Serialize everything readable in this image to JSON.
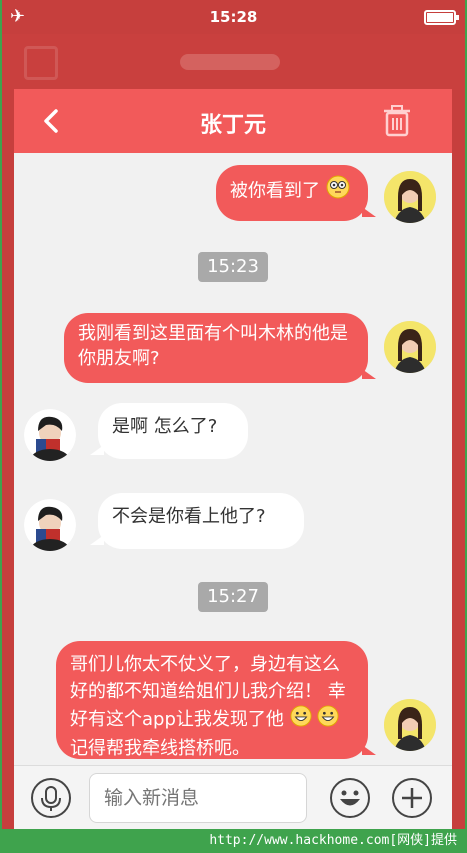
{
  "status_bar": {
    "time": "15:28"
  },
  "header": {
    "title": "张丁元"
  },
  "messages": [
    {
      "side": "me",
      "text": "被你看到了"
    },
    {
      "stamp": "15:23"
    },
    {
      "side": "me",
      "text": "我刚看到这里面有个叫木林的他是你朋友啊?"
    },
    {
      "side": "other",
      "text": "是啊 怎么了?"
    },
    {
      "side": "other",
      "text": "不会是你看上他了?"
    },
    {
      "stamp": "15:27"
    },
    {
      "side": "me",
      "text": "哥们儿你太不仗义了，身边有这么好的都不知道给姐们儿我介绍！ 幸好有这个app让我发现了他",
      "text_tail": "记得帮我牵线搭桥呃。"
    }
  ],
  "input": {
    "placeholder": "输入新消息"
  },
  "watermark": "http://www.hackhome.com[网侠]提供",
  "colors": {
    "accent": "#f25a5a",
    "stamp": "#a9a9a9",
    "background": "#f1f1f1"
  }
}
